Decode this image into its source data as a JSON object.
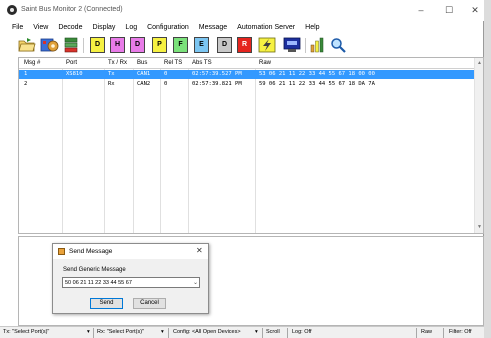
{
  "window": {
    "title": "Saint Bus Monitor 2 (Connected)",
    "min": "–",
    "max": "☐",
    "close": "✕"
  },
  "menu": [
    "File",
    "View",
    "Decode",
    "Display",
    "Log",
    "Configuration",
    "Message",
    "Automation Server",
    "Help"
  ],
  "toolbar": {
    "letters": [
      {
        "label": "D",
        "color": "#f6f142"
      },
      {
        "label": "H",
        "color": "#e87be8"
      },
      {
        "label": "D",
        "color": "#e87be8"
      },
      {
        "label": "P",
        "color": "#f6f142"
      },
      {
        "label": "F",
        "color": "#7be27b"
      },
      {
        "label": "E",
        "color": "#7cc6f2"
      },
      {
        "label": "D",
        "color": "#c8c8c8"
      },
      {
        "label": "R",
        "color": "#e5251f"
      }
    ]
  },
  "grid": {
    "columns": [
      "Msg #",
      "Port",
      "Tx / Rx",
      "Bus",
      "Rel TS",
      "Abs TS",
      "Raw"
    ],
    "rows": [
      {
        "msg": "1",
        "port": "XS810",
        "txrx": "Tx",
        "bus": "CAN1",
        "rel": "0",
        "abs": "02:57:39.527 PM",
        "raw": "53 06 21 11 22 33 44 55 67 18 00 00"
      },
      {
        "msg": "2",
        "port": "",
        "txrx": "Rx",
        "bus": "CAN2",
        "rel": "0",
        "abs": "02:57:39.821 PM",
        "raw": "59 06 21 11 22 33 44 55 67 18 DA 7A"
      }
    ]
  },
  "dialog": {
    "title": "Send Message",
    "label": "Send Generic Message",
    "value": "50 06 21 11 22 33 44 55 67",
    "send": "Send",
    "cancel": "Cancel"
  },
  "status": {
    "tx": "Tx: \"Select Port(s)\"",
    "rx": "Rx: \"Select Port(s)\"",
    "config": "Config: <All Open Devices>",
    "scroll": "Scroll",
    "log": "Log: Off",
    "raw": "Raw",
    "filter": "Filter: Off"
  }
}
